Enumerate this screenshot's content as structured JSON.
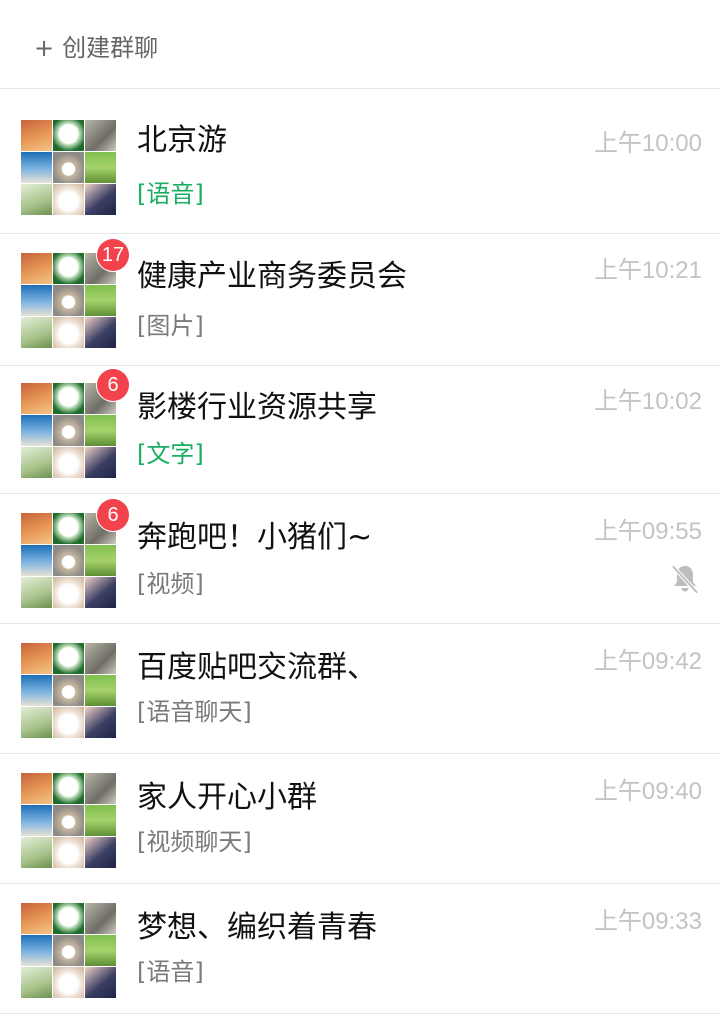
{
  "header": {
    "create_label": "创建群聊",
    "plus_icon": "+"
  },
  "colors": {
    "badge": "#f2434d",
    "green_message": "#1aae62",
    "time": "#c3c3c3",
    "divider": "#e6e6e6"
  },
  "chats": [
    {
      "name": "北京游",
      "message": "[语音]",
      "message_color": "green",
      "time": "上午10:00",
      "badge": "",
      "muted": false
    },
    {
      "name": "健康产业商务委员会",
      "message": "[图片]",
      "message_color": "gray",
      "time": "上午10:21",
      "badge": "17",
      "muted": false
    },
    {
      "name": "影楼行业资源共享",
      "message": "[文字]",
      "message_color": "green",
      "time": "上午10:02",
      "badge": "6",
      "muted": false
    },
    {
      "name": "奔跑吧！小猪们~",
      "message": "[视频]",
      "message_color": "gray",
      "time": "上午09:55",
      "badge": "6",
      "muted": true,
      "mute_icon": "bell-slash-icon"
    },
    {
      "name": "百度贴吧交流群、",
      "message": "[语音聊天]",
      "message_color": "gray",
      "time": "上午09:42",
      "badge": "",
      "muted": false
    },
    {
      "name": "家人开心小群",
      "message": "[视频聊天]",
      "message_color": "gray",
      "time": "上午09:40",
      "badge": "",
      "muted": false
    },
    {
      "name": "梦想、编织着青春",
      "message": "[语音]",
      "message_color": "gray",
      "time": "上午09:33",
      "badge": "",
      "muted": false
    }
  ]
}
